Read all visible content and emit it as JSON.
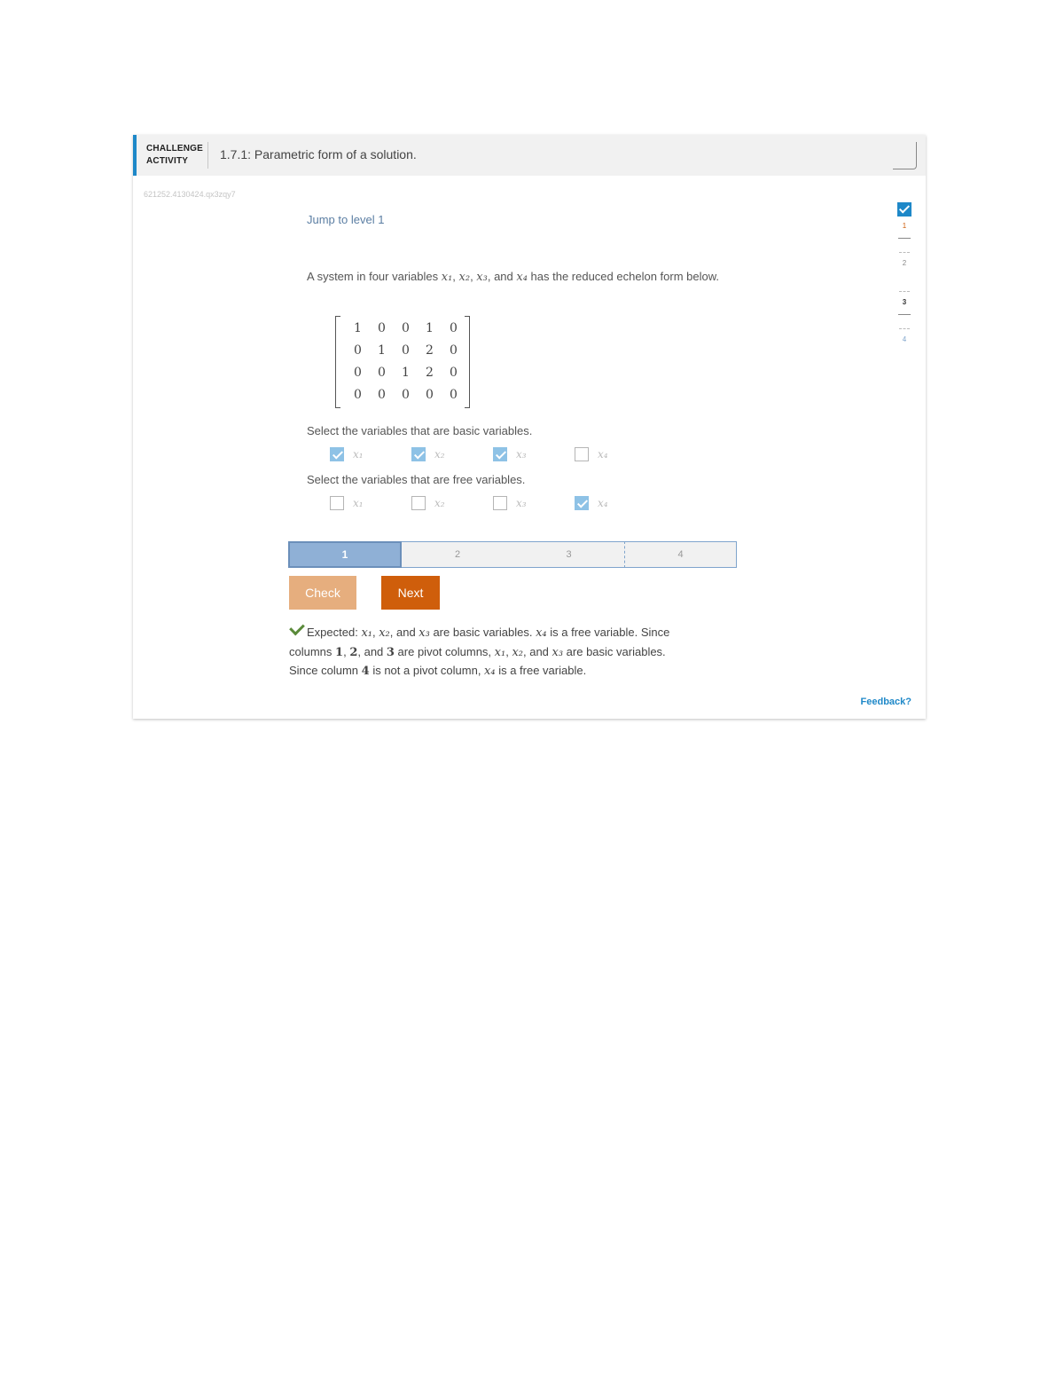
{
  "header": {
    "badge_line1": "CHALLENGE",
    "badge_line2": "ACTIVITY",
    "title": "1.7.1: Parametric form of a solution."
  },
  "activity_id": "621252.4130424.qx3zqy7",
  "jump_link": "Jump to level 1",
  "prompt": {
    "text1": "A system in four variables ",
    "sep1": ", ",
    "sep2": ", ",
    "sep3": ", and ",
    "text2": " has the reduced echelon form below.",
    "vars": [
      "x₁",
      "x₂",
      "x₃",
      "x₄"
    ]
  },
  "matrix": [
    [
      "1",
      "0",
      "0",
      "1",
      "0"
    ],
    [
      "0",
      "1",
      "0",
      "2",
      "0"
    ],
    [
      "0",
      "0",
      "1",
      "2",
      "0"
    ],
    [
      "0",
      "0",
      "0",
      "0",
      "0"
    ]
  ],
  "question_basic": "Select the variables that are basic variables.",
  "basic_options": [
    {
      "label": "x₁",
      "checked": true
    },
    {
      "label": "x₂",
      "checked": true
    },
    {
      "label": "x₃",
      "checked": true
    },
    {
      "label": "x₄",
      "checked": false
    }
  ],
  "question_free": "Select the variables that are free variables.",
  "free_options": [
    {
      "label": "x₁",
      "checked": false
    },
    {
      "label": "x₂",
      "checked": false
    },
    {
      "label": "x₃",
      "checked": false
    },
    {
      "label": "x₄",
      "checked": true
    }
  ],
  "progress": {
    "segments": [
      "1",
      "2",
      "3",
      "4"
    ],
    "active_index": 0
  },
  "buttons": {
    "check": "Check",
    "next": "Next"
  },
  "feedback": {
    "t1": "Expected: ",
    "v1": "x₁",
    "t2": ", ",
    "v2": "x₂",
    "t3": ", and ",
    "v3": "x₃",
    "t4": " are basic variables. ",
    "v4": "x₄",
    "t5": " is a free variable. Since columns ",
    "n1": "1",
    "t6": ", ",
    "n2": "2",
    "t7": ", and ",
    "n3": "3",
    "t8": " are pivot columns, ",
    "v5": "x₁",
    "t9": ", ",
    "v6": "x₂",
    "t10": ", and ",
    "v7": "x₃",
    "t11": " are basic variables. Since column ",
    "n4": "4",
    "t12": " is not a pivot column, ",
    "v8": "x₄",
    "t13": " is a free variable."
  },
  "feedback_link": "Feedback?",
  "levels": [
    "1",
    "2",
    "3",
    "4"
  ],
  "colors": {
    "accent": "#1e88c8",
    "next_button": "#cf5e0b",
    "check_button": "#e6ae7e",
    "checked_box": "#8ec2e6",
    "success": "#5a8a3a"
  }
}
